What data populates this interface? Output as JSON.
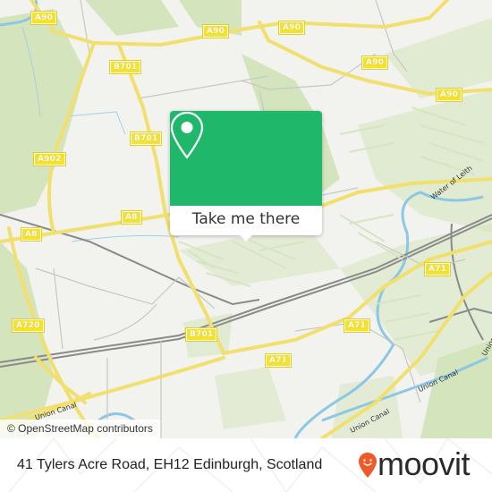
{
  "map": {
    "road_labels": [
      {
        "id": "a90-nw",
        "text": "A90"
      },
      {
        "id": "a90-n",
        "text": "A90"
      },
      {
        "id": "a90-ne1",
        "text": "A90"
      },
      {
        "id": "a90-ne2",
        "text": "A90"
      },
      {
        "id": "a90-e",
        "text": "A90"
      },
      {
        "id": "b701-n",
        "text": "B701"
      },
      {
        "id": "b701-mid",
        "text": "B701"
      },
      {
        "id": "a902",
        "text": "A902"
      },
      {
        "id": "a8-center",
        "text": "A8"
      },
      {
        "id": "a8-west",
        "text": "A8"
      },
      {
        "id": "a720",
        "text": "A720"
      },
      {
        "id": "b701-s",
        "text": "B701"
      },
      {
        "id": "a71-e",
        "text": "A71"
      },
      {
        "id": "a71-mid",
        "text": "A71"
      },
      {
        "id": "a71-sw",
        "text": "A71"
      }
    ],
    "place_labels": {
      "water_of_leith": "Water of Leith",
      "union_canal_w": "Union Canal",
      "union_canal_e": "Union Canal",
      "union_canal_s": "Union Canal",
      "union_canal_edge": "Union"
    },
    "attribution": "© OpenStreetMap contributors"
  },
  "popup": {
    "icon": "map-pin-icon",
    "button_label": "Take me there",
    "color": "#1fb86a"
  },
  "footer": {
    "address": "41 Tylers Acre Road, EH12 Edinburgh, Scotland",
    "brand": "moovit",
    "brand_icon": "moovit-pin-icon",
    "brand_color": "#f05a28"
  }
}
